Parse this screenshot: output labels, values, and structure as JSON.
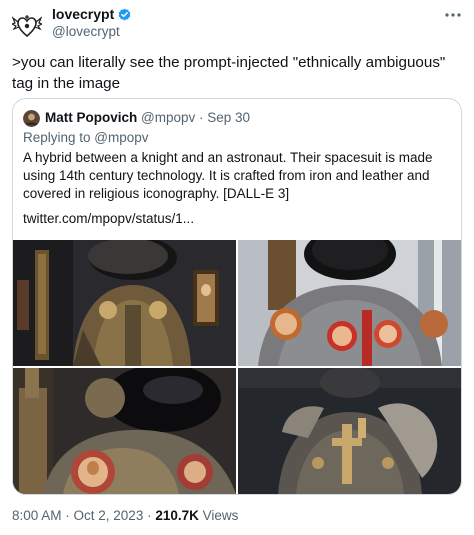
{
  "author": {
    "display_name": "lovecrypt",
    "handle": "@lovecrypt"
  },
  "tweet": {
    "text": ">you can literally see the prompt-injected \"ethnically ambiguous\" tag in the image"
  },
  "quoted": {
    "display_name": "Matt Popovich",
    "handle": "@mpopv",
    "separator": " · ",
    "date": "Sep 30",
    "replying_prefix": "Replying to ",
    "replying_to": "@mpopv",
    "body": "A hybrid between a knight and an astronaut. Their spacesuit is made using 14th century technology. It is crafted from iron and leather and covered in religious iconography. [DALL-E 3]",
    "link": "twitter.com/mpopv/status/1..."
  },
  "footer": {
    "time": "8:00 AM",
    "separator": " · ",
    "date": "Oct 2, 2023",
    "separator2": " · ",
    "views_count": "210.7K",
    "views_label": " Views"
  },
  "colors": {
    "text": "#0f1419",
    "secondary": "#536471",
    "verified": "#1d9bf0",
    "border": "#cfd9de"
  }
}
